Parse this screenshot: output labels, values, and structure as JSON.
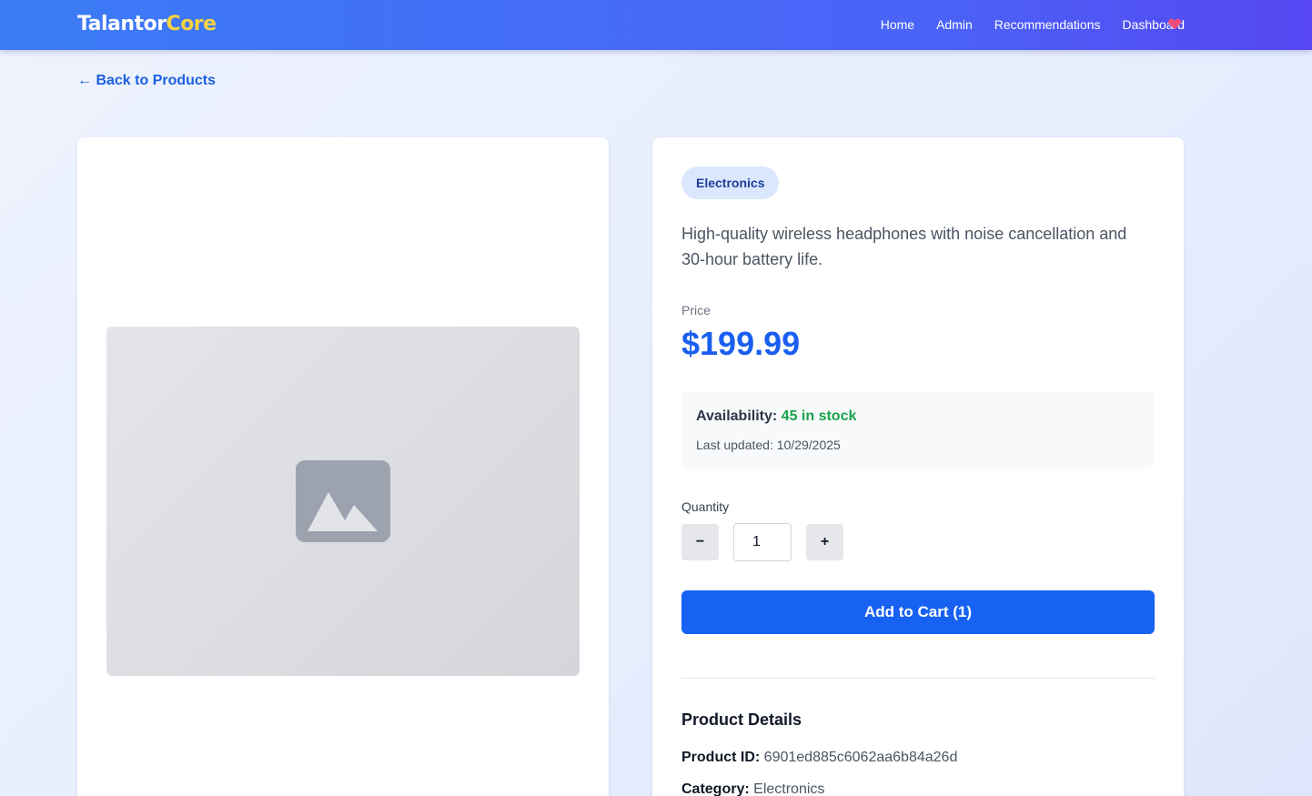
{
  "brand": {
    "name_main": "Talantor",
    "name_accent": "Core"
  },
  "nav": {
    "items": [
      "Home",
      "Admin",
      "Recommendations",
      "Dashboard"
    ],
    "heart_icon": "heart-icon"
  },
  "back_link": "← Back to Products",
  "product": {
    "category": "Electronics",
    "description": "High-quality wireless headphones with noise cancellation and 30-hour battery life.",
    "price_label": "Price",
    "price": "$199.99",
    "availability_label": "Availability:",
    "availability_value": "45 in stock",
    "last_updated": "Last updated: 10/29/2025",
    "quantity_label": "Quantity",
    "quantity_value": "1",
    "minus_label": "−",
    "plus_label": "+",
    "add_to_cart": "Add to Cart (1)"
  },
  "details": {
    "title": "Product Details",
    "id_label": "Product ID:",
    "id_value": "6901ed885c6062aa6b84a26d",
    "category_label": "Category:",
    "category_value": "Electronics"
  },
  "colors": {
    "accent": "#1762f2",
    "brand_accent": "#f9d342",
    "in_stock": "#16a34a",
    "badge_bg": "#dbe7fd"
  }
}
